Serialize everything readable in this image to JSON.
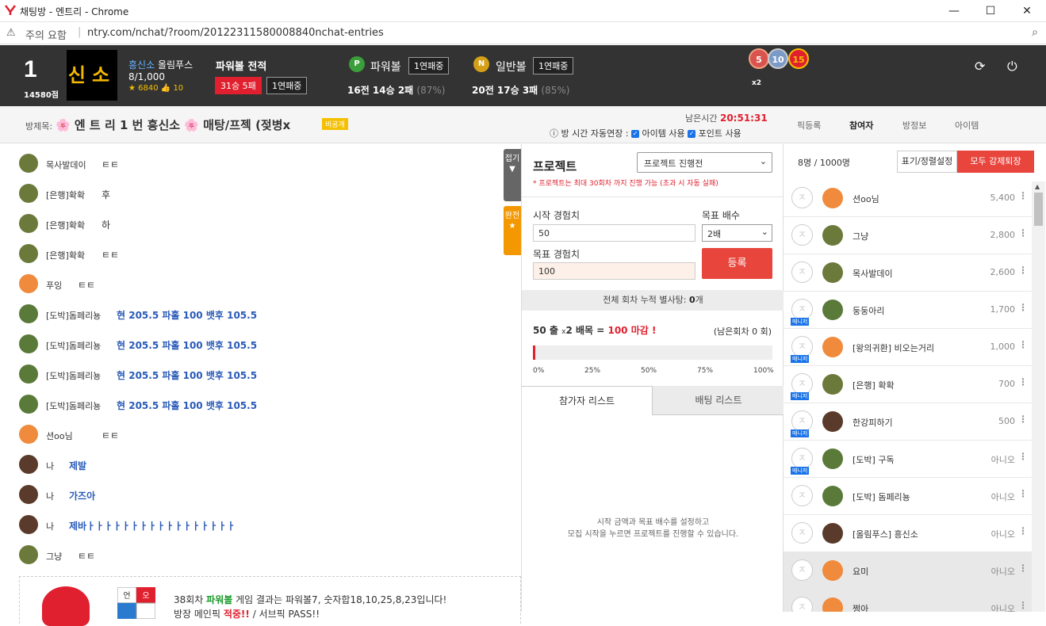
{
  "window": {
    "title": "채팅방 - 엔트리 - Chrome",
    "minimize": "—",
    "maximize": "☐",
    "close": "✕"
  },
  "address": {
    "security": "주의 요함",
    "url": "ntry.com/nchat/?room/20122311580008840nchat-entries"
  },
  "profile": {
    "rank": "1",
    "points": "14580점",
    "avatar_text": "신소",
    "name_prefix": "흥신소",
    "name_suffix": "올림푸스",
    "count": "8/1,000",
    "stat_star": "6840",
    "stat_like": "10"
  },
  "powerball_record": {
    "title": "파워볼 전적",
    "wins_label": "31승 5패",
    "streak_label": "1연패중"
  },
  "games": [
    {
      "icon": "P",
      "name": "파워볼",
      "streak": "1연패중",
      "record": "16전 14승 2패",
      "pct": "(87%)",
      "color": "#3a9e3a"
    },
    {
      "icon": "N",
      "name": "일반볼",
      "streak": "1연패중",
      "record": "20전 17승 3패",
      "pct": "(85%)",
      "color": "#d4a017"
    }
  ],
  "medals": {
    "items": [
      "5",
      "10",
      "15"
    ],
    "multiplier": "x2"
  },
  "header_icons": {
    "refresh": "⟳",
    "power": "⏻"
  },
  "room": {
    "label": "방제목:",
    "title": "🌸 엔 트 리 1 번 흥신소 🌸 매탕/프젝 (젖병x",
    "private": "비공개",
    "remain_label": "남은시간",
    "remain_time": "20:51:31",
    "auto_extend": "방 시간 자동연장 :",
    "opt_item": "아이템 사용",
    "opt_point": "포인트 사용",
    "tabs": [
      "픽등록",
      "참여자",
      "방정보",
      "아이템"
    ]
  },
  "chat": {
    "fold": "접기",
    "done": "완전",
    "messages": [
      {
        "name": "목사발데이",
        "text": "ㅌㅌ",
        "face": "#6b7a3a",
        "blue": false
      },
      {
        "name": "[은행]확확",
        "text": "후",
        "face": "#6b7a3a",
        "blue": false
      },
      {
        "name": "[은행]확확",
        "text": "하",
        "face": "#6b7a3a",
        "blue": false
      },
      {
        "name": "[은행]확확",
        "text": "ㅌㅌ",
        "face": "#6b7a3a",
        "blue": false
      },
      {
        "name": "푸잉",
        "text": "ㅌㅌ",
        "face": "#f08a3c",
        "blue": false
      },
      {
        "name": "[도박]돔페리뇽",
        "text": "현 205.5 파홀 100 뱃후 105.5",
        "face": "#5a7a3a",
        "blue": true
      },
      {
        "name": "[도박]돔페리뇽",
        "text": "현 205.5 파홀 100 뱃후 105.5",
        "face": "#5a7a3a",
        "blue": true
      },
      {
        "name": "[도박]돔페리뇽",
        "text": "현 205.5 파홀 100 뱃후 105.5",
        "face": "#5a7a3a",
        "blue": true
      },
      {
        "name": "[도박]돔페리뇽",
        "text": "현 205.5 파홀 100 뱃후 105.5",
        "face": "#5a7a3a",
        "blue": true
      },
      {
        "name": "션oo님",
        "text": "ㅌㅌ",
        "face": "#f08a3c",
        "blue": false
      },
      {
        "name": "나",
        "text": "제발",
        "face": "#5a3a2a",
        "blue": true
      },
      {
        "name": "나",
        "text": "가즈아",
        "face": "#5a3a2a",
        "blue": true
      },
      {
        "name": "나",
        "text": "제바ㅏㅏㅏㅏㅏㅏㅏㅏㅏㅏㅏㅏㅏㅏㅏㅏㅏ",
        "face": "#5a3a2a",
        "blue": true
      },
      {
        "name": "그냥",
        "text": "ㅌㅌ",
        "face": "#6b7a3a",
        "blue": false
      }
    ],
    "notice": {
      "grid": [
        "언",
        "오",
        "",
        ""
      ],
      "line1_a": "38회차 ",
      "line1_game": "파워볼",
      "line1_b": " 게임 결과는 파워볼7, 숫자합18,10,25,8,23입니다!",
      "line2_a": "방장 메인픽 ",
      "line2_b": "적중!!",
      "line2_c": " / 서브픽 PASS!!"
    }
  },
  "project": {
    "title": "프로젝트",
    "status": "프로젝트 진행전",
    "note": "* 프로젝트는 최대 30회차 까지 진행 가능 (초과 시 자동 실패)",
    "start_label": "시작 경험치",
    "start_value": "50",
    "mult_label": "목표 배수",
    "mult_value": "2배",
    "target_label": "목표 경험치",
    "target_value": "100",
    "register": "등록",
    "cumulative": "전체 회차 누적 별사탕: ",
    "cumulative_count": "0",
    "cumulative_unit": "개",
    "goal_a": "50 출",
    "goal_x": "x",
    "goal_b": "2 배목 = ",
    "goal_c": "100 마감 !",
    "remaining_rounds": "(남은회차 0 회)",
    "progress": 0.01,
    "ticks": [
      "0%",
      "25%",
      "50%",
      "75%",
      "100%"
    ],
    "tab_participants": "참가자 리스트",
    "tab_bets": "배팅 리스트",
    "empty_1": "시작 금액과 목표 배수를 설정하고",
    "empty_2": "모집 시작을 누르면 프로젝트를 진행할 수 있습니다."
  },
  "users": {
    "count": "8명 / 1000명",
    "sort_btn": "표기/정렬설정",
    "kick_btn": "모두 강제퇴장",
    "list": [
      {
        "name": "션oo님",
        "points": "5,400",
        "manager": false,
        "face": "#f08a3c",
        "gray": false
      },
      {
        "name": "그냥",
        "points": "2,800",
        "manager": false,
        "face": "#6b7a3a",
        "gray": false
      },
      {
        "name": "목사발데이",
        "points": "2,600",
        "manager": false,
        "face": "#6b7a3a",
        "gray": false
      },
      {
        "name": "둥둥아리",
        "points": "1,700",
        "manager": true,
        "face": "#5a7a3a",
        "gray": false
      },
      {
        "name": "[왕의귀환] 비오는거리",
        "points": "1,000",
        "manager": true,
        "face": "#f08a3c",
        "gray": false
      },
      {
        "name": "[은행] 확확",
        "points": "700",
        "manager": true,
        "face": "#6b7a3a",
        "gray": false
      },
      {
        "name": "한강피하기",
        "points": "500",
        "manager": true,
        "face": "#5a3a2a",
        "gray": false
      },
      {
        "name": "[도박] 구독",
        "points": "아니오",
        "manager": true,
        "face": "#5a7a3a",
        "gray": false
      },
      {
        "name": "[도박] 돔페리뇽",
        "points": "아니오",
        "manager": false,
        "face": "#5a7a3a",
        "gray": false
      },
      {
        "name": "[올림푸스] 흥신소",
        "points": "아니오",
        "manager": false,
        "face": "#5a3a2a",
        "gray": false
      },
      {
        "name": "요미",
        "points": "아니오",
        "manager": false,
        "face": "#f08a3c",
        "gray": true
      },
      {
        "name": "쩡아",
        "points": "아니오",
        "manager": false,
        "face": "#f08a3c",
        "gray": true
      }
    ],
    "manager_label": "매니저"
  }
}
